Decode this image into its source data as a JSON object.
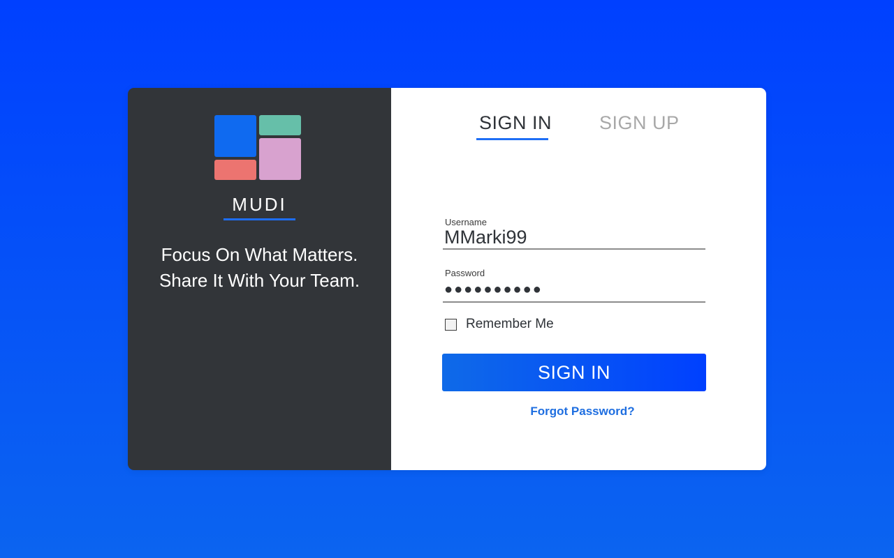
{
  "brand": {
    "name": "MUDI",
    "logo_colors": [
      "#0f6af0",
      "#66bfa9",
      "#d8a2cf",
      "#ec7470"
    ],
    "tagline_line1": "Focus On What Matters.",
    "tagline_line2": "Share It With Your Team."
  },
  "tabs": {
    "sign_in": "SIGN IN",
    "sign_up": "SIGN UP",
    "active": "sign_in"
  },
  "form": {
    "username_label": "Username",
    "username_value": "MMarki99",
    "password_label": "Password",
    "password_value": "●●●●●●●●●●",
    "remember_label": "Remember Me",
    "remember_checked": false,
    "submit_label": "SIGN IN",
    "forgot_label": "Forgot Password?"
  },
  "colors": {
    "accent": "#1e6ef5",
    "background_top": "#0040ff",
    "background_bottom": "#0b64f0",
    "left_panel": "#323539"
  }
}
